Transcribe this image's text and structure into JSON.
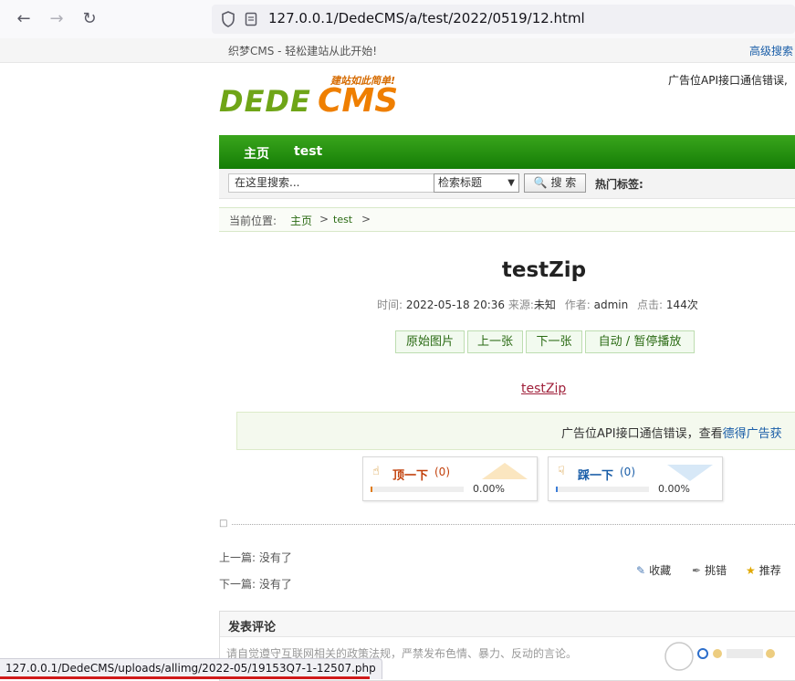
{
  "browser": {
    "url": "127.0.0.1/DedeCMS/a/test/2022/0519/12.html",
    "status_url": "127.0.0.1/DedeCMS/uploads/allimg/2022-05/19153Q7-1-12507.php"
  },
  "site": {
    "slogan": "织梦CMS - 轻松建站从此开始!",
    "advanced_search": "高级搜索",
    "logo_tagline": "建站如此简单!",
    "logo_dede": "DEDE",
    "logo_cms": "CMS",
    "top_ad_error": "广告位API接口通信错误,"
  },
  "nav": {
    "items": [
      {
        "label": "主页"
      },
      {
        "label": "test"
      }
    ]
  },
  "search": {
    "placeholder": "在这里搜索...",
    "select_value": "检索标题",
    "button": "搜 索",
    "hot_tags": "热门标签:"
  },
  "breadcrumb": {
    "prefix": "当前位置:",
    "items": [
      "主页",
      "test"
    ],
    "separator": ">"
  },
  "article": {
    "title": "testZip",
    "time_label": "时间:",
    "time": "2022-05-18 20:36",
    "source_label": "来源:",
    "source": "未知",
    "author_label": "作者:",
    "author": "admin",
    "clicks_label": "点击:",
    "clicks": "144次",
    "buttons": [
      "原始图片",
      "上一张",
      "下一张",
      "自动 / 暂停播放"
    ],
    "image_link": "testZip"
  },
  "ad_box": {
    "text": "广告位API接口通信错误，查看",
    "link": "德得广告获"
  },
  "votes": {
    "up": {
      "label": "顶一下",
      "count": "(0)",
      "percent": "0.00%",
      "fraction": 0
    },
    "down": {
      "label": "踩一下",
      "count": "(0)",
      "percent": "0.00%",
      "fraction": 0
    }
  },
  "prev_next": {
    "prev": "上一篇: 没有了",
    "next": "下一篇: 没有了"
  },
  "actions": {
    "favorite": "收藏",
    "report": "挑错",
    "recommend": "推荐"
  },
  "comment": {
    "header": "发表评论",
    "notice": "请自觉遵守互联网相关的政策法规，严禁发布色情、暴力、反动的言论。"
  },
  "colors": {
    "nav_green": "#148a0b",
    "link_red": "#a0213b",
    "status_underline": "#d01a1a"
  }
}
